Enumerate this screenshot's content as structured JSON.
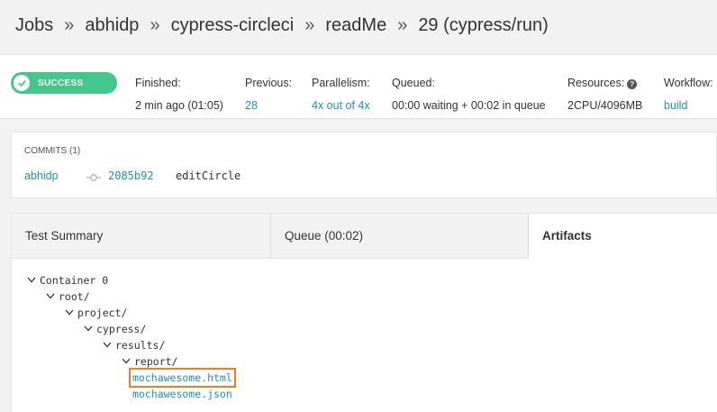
{
  "breadcrumb": {
    "items": [
      "Jobs",
      "abhidp",
      "cypress-circleci",
      "readMe",
      "29 (cypress/run)"
    ],
    "separator": "»"
  },
  "status": {
    "badge": "SUCCESS",
    "finished_label": "Finished:",
    "finished_value": "2 min ago (01:05)",
    "previous_label": "Previous:",
    "previous_value": "28",
    "parallelism_label": "Parallelism:",
    "parallelism_value": "4x out of 4x",
    "queued_label": "Queued:",
    "queued_value": "00:00 waiting + 00:02 in queue",
    "resources_label": "Resources:",
    "resources_value": "2CPU/4096MB",
    "workflow_label": "Workflow:",
    "workflow_value": "build"
  },
  "commits": {
    "title": "COMMITS (1)",
    "author": "abhidp",
    "hash": "2085b92",
    "message": "editCircle"
  },
  "tabs": [
    "Test Summary",
    "Queue (00:02)",
    "Artifacts"
  ],
  "tree": {
    "container": "Container 0",
    "root": "root/",
    "project": "project/",
    "cypress": "cypress/",
    "results": "results/",
    "report": "report/",
    "files": [
      "mochawesome.html",
      "mochawesome.json"
    ]
  },
  "colors": {
    "success": "#42c88a",
    "link": "#1f8fb3",
    "highlight": "#ee7e22"
  }
}
